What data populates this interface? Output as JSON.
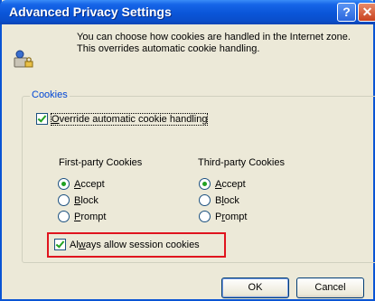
{
  "window": {
    "title": "Advanced Privacy Settings",
    "help_label": "?",
    "close_label": "✕"
  },
  "info": {
    "icon": "privacy-settings-icon",
    "text": "You can choose how cookies are handled in the Internet zone.  This overrides automatic cookie handling."
  },
  "cookies": {
    "group_label": "Cookies",
    "override_label": "Override automatic cookie handling",
    "override_checked": true,
    "first_party": {
      "heading": "First-party Cookies",
      "options": [
        "Accept",
        "Block",
        "Prompt"
      ],
      "selected": "Accept"
    },
    "third_party": {
      "heading": "Third-party Cookies",
      "options": [
        "Accept",
        "Block",
        "Prompt"
      ],
      "selected": "Accept"
    },
    "session_label": "Always allow session cookies",
    "session_checked": true
  },
  "buttons": {
    "ok": "OK",
    "cancel": "Cancel"
  },
  "colors": {
    "titlebar": "#0a55d8",
    "highlight_border": "#e0141e",
    "check_green": "#21a121",
    "group_label": "#0046d5"
  }
}
